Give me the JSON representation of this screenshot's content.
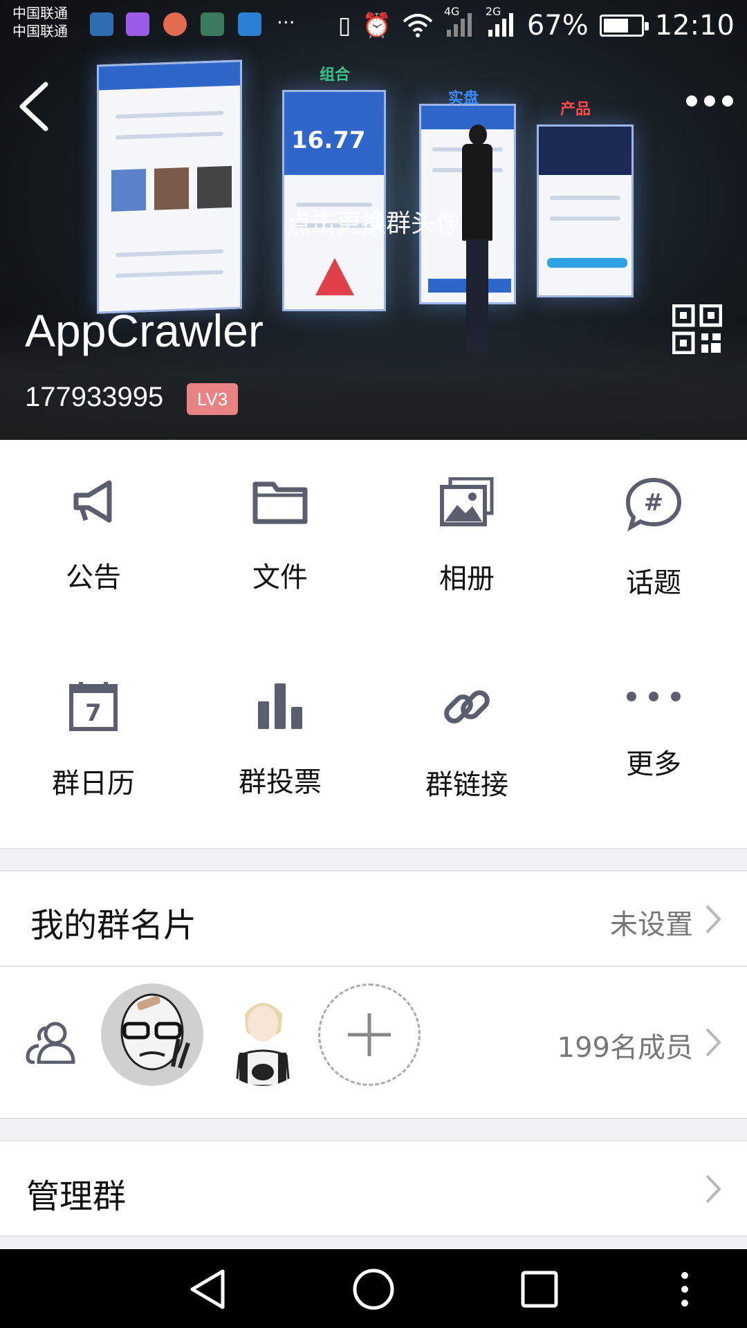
{
  "status": {
    "carrier_1": "中国联通",
    "carrier_2": "中国联通",
    "network_4g": "4G",
    "network_2g": "2G",
    "battery": "67%",
    "battery_level": 0.67,
    "time": "12:10"
  },
  "stage_labels": [
    "组合",
    "实盘",
    "产品"
  ],
  "stage_number": "16.77",
  "hero": {
    "change_avatar": "点击更换群头像",
    "group_name": "AppCrawler",
    "group_id": "177933995",
    "level": "LV3"
  },
  "grid": [
    {
      "label": "公告",
      "icon": "megaphone-icon"
    },
    {
      "label": "文件",
      "icon": "folder-icon"
    },
    {
      "label": "相册",
      "icon": "photo-album-icon"
    },
    {
      "label": "话题",
      "icon": "topic-icon"
    },
    {
      "label": "群日历",
      "icon": "calendar-icon",
      "day": "7"
    },
    {
      "label": "群投票",
      "icon": "bar-chart-icon"
    },
    {
      "label": "群链接",
      "icon": "link-icon"
    },
    {
      "label": "更多",
      "icon": "more-icon"
    }
  ],
  "my_card": {
    "label": "我的群名片",
    "value": "未设置"
  },
  "members": {
    "count_label": "199名成员"
  },
  "manage": {
    "label": "管理群"
  },
  "colors": {
    "badge": "#e98383",
    "icon": "#5b5e6e"
  }
}
